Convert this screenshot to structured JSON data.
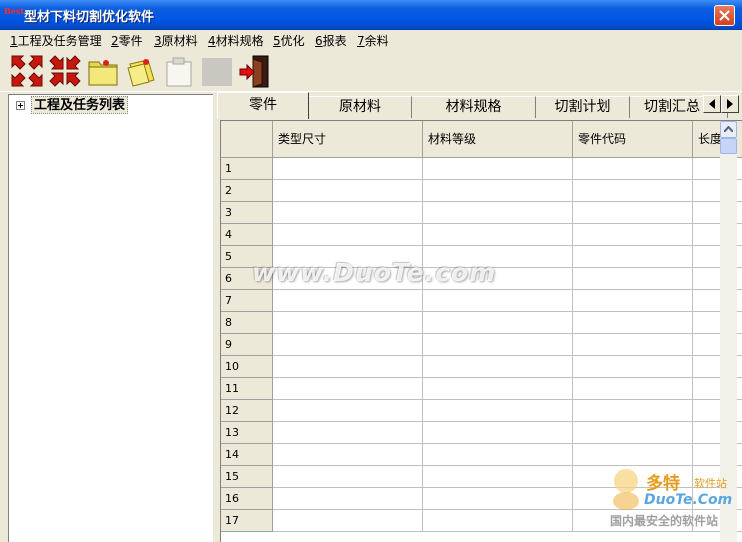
{
  "window": {
    "title": "型材下料切割优化软件",
    "icon_label": "Best"
  },
  "menu": [
    {
      "key": "1",
      "label": "工程及任务管理"
    },
    {
      "key": "2",
      "label": "零件"
    },
    {
      "key": "3",
      "label": "原材料"
    },
    {
      "key": "4",
      "label": "材料规格"
    },
    {
      "key": "5",
      "label": "优化"
    },
    {
      "key": "6",
      "label": "报表"
    },
    {
      "key": "7",
      "label": "余料"
    }
  ],
  "toolbar": {
    "icons": [
      "expand-all-icon",
      "collapse-all-icon",
      "open-folder-icon",
      "notes-icon",
      "save-icon-disabled",
      "blank-icon-disabled",
      "exit-door-icon"
    ]
  },
  "tree": {
    "root_label": "工程及任务列表"
  },
  "tabs": [
    {
      "label": "零件",
      "active": true
    },
    {
      "label": "原材料"
    },
    {
      "label": "材料规格"
    },
    {
      "label": "切割计划"
    },
    {
      "label": "切割汇总"
    }
  ],
  "grid": {
    "columns": [
      "类型尺寸",
      "材料等级",
      "零件代码",
      "长度"
    ],
    "rows": [
      "1",
      "2",
      "3",
      "4",
      "5",
      "6",
      "7",
      "8",
      "9",
      "10",
      "11",
      "12",
      "13",
      "14",
      "15",
      "16",
      "17"
    ]
  },
  "watermark": {
    "text": "www.DuoTe.com"
  },
  "corner_logo": {
    "title": "多特",
    "subtitle": "软件站",
    "site": "DuoTe.Com",
    "tagline": "国内最安全的软件站"
  },
  "colors": {
    "titlebar": "#0054e3",
    "face": "#ece9d8",
    "close": "#d4401c"
  }
}
